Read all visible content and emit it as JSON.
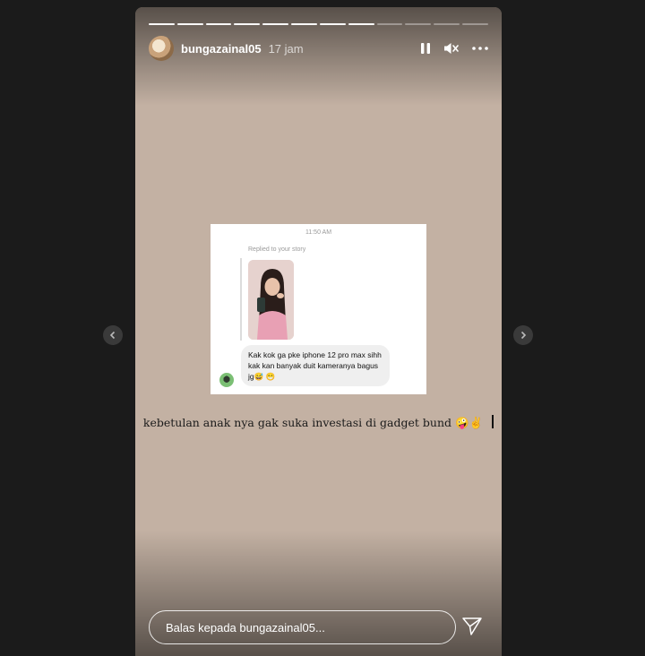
{
  "story": {
    "username": "bungazainal05",
    "time": "17 jam",
    "progress_total": 12,
    "progress_done": 8,
    "caption": "kebetulan anak nya gak suka investasi di gadget bund",
    "caption_emoji": "🤪✌️"
  },
  "screenshot_card": {
    "time": "11:50 AM",
    "replied": "Replied to your story",
    "message": "Kak kok ga pke iphone 12 pro max sihh kak kan banyak duit kameranya bagus jg😅 😁"
  },
  "reply": {
    "placeholder": "Balas kepada bungazainal05..."
  },
  "icons": {
    "pause": "pause-icon",
    "mute": "mute-icon",
    "more": "more-icon",
    "send": "send-icon",
    "prev": "chevron-left-icon",
    "next": "chevron-right-icon"
  }
}
